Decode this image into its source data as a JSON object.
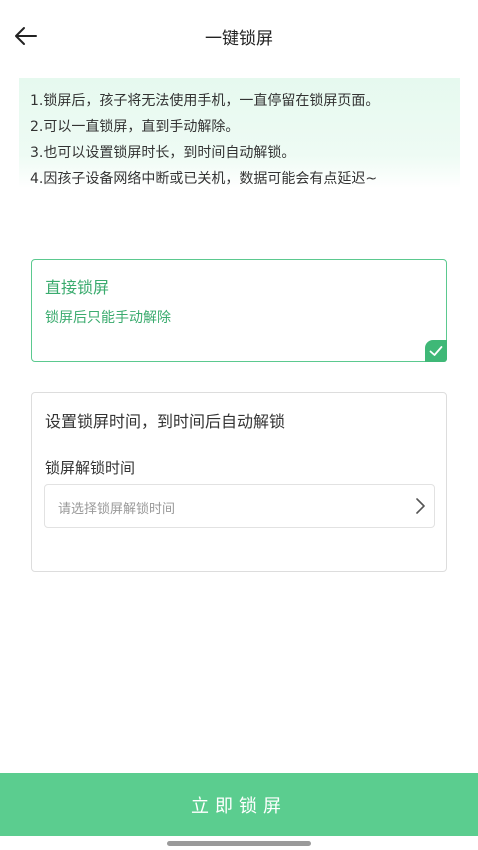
{
  "header": {
    "title": "一键锁屏",
    "back_icon": "arrow-left-icon"
  },
  "notice": {
    "lines": [
      "1.锁屏后，孩子将无法使用手机，一直停留在锁屏页面。",
      "2.可以一直锁屏，直到手动解除。",
      "3.也可以设置锁屏时长，到时间自动解锁。",
      "4.因孩子设备网络中断或已关机，数据可能会有点延迟~"
    ]
  },
  "direct_lock": {
    "title": "直接锁屏",
    "subtitle": "锁屏后只能手动解除",
    "selected": true,
    "icon": "check-icon"
  },
  "timed_lock": {
    "title": "设置锁屏时间，到时间后自动解锁",
    "field_label": "锁屏解锁时间",
    "placeholder": "请选择锁屏解锁时间",
    "icon": "chevron-right-icon"
  },
  "action": {
    "lock_label": "立即锁屏"
  },
  "colors": {
    "accent": "#5bcd8f",
    "accent_text": "#3aab6e",
    "notice_bg": "#e6f9ef"
  }
}
